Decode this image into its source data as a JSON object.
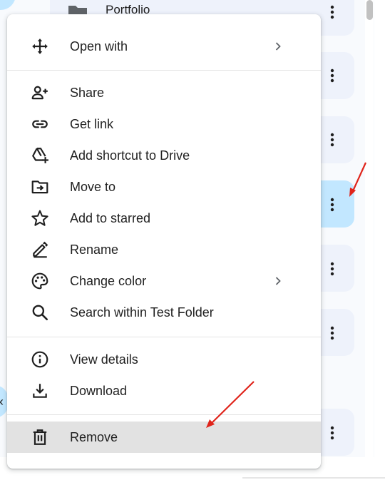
{
  "background": {
    "first_row_title": "Portfolio",
    "accent_selected": "#c2e7ff",
    "card_color": "#eef2fb"
  },
  "menu": {
    "items": [
      {
        "label": "Open with",
        "icon": "move-icon",
        "submenu": true
      },
      {
        "label": "Share",
        "icon": "person-add-icon",
        "submenu": false
      },
      {
        "label": "Get link",
        "icon": "link-icon",
        "submenu": false
      },
      {
        "label": "Add shortcut to Drive",
        "icon": "drive-shortcut-icon",
        "submenu": false
      },
      {
        "label": "Move to",
        "icon": "folder-move-icon",
        "submenu": false
      },
      {
        "label": "Add to starred",
        "icon": "star-icon",
        "submenu": false
      },
      {
        "label": "Rename",
        "icon": "rename-pen-icon",
        "submenu": false
      },
      {
        "label": "Change color",
        "icon": "palette-icon",
        "submenu": true
      },
      {
        "label": "Search within Test Folder",
        "icon": "search-icon",
        "submenu": false
      },
      {
        "label": "View details",
        "icon": "info-icon",
        "submenu": false
      },
      {
        "label": "Download",
        "icon": "download-icon",
        "submenu": false
      },
      {
        "label": "Remove",
        "icon": "trash-icon",
        "submenu": false,
        "highlighted": true
      }
    ]
  },
  "annotations": {
    "arrow_color": "#e0241b"
  }
}
